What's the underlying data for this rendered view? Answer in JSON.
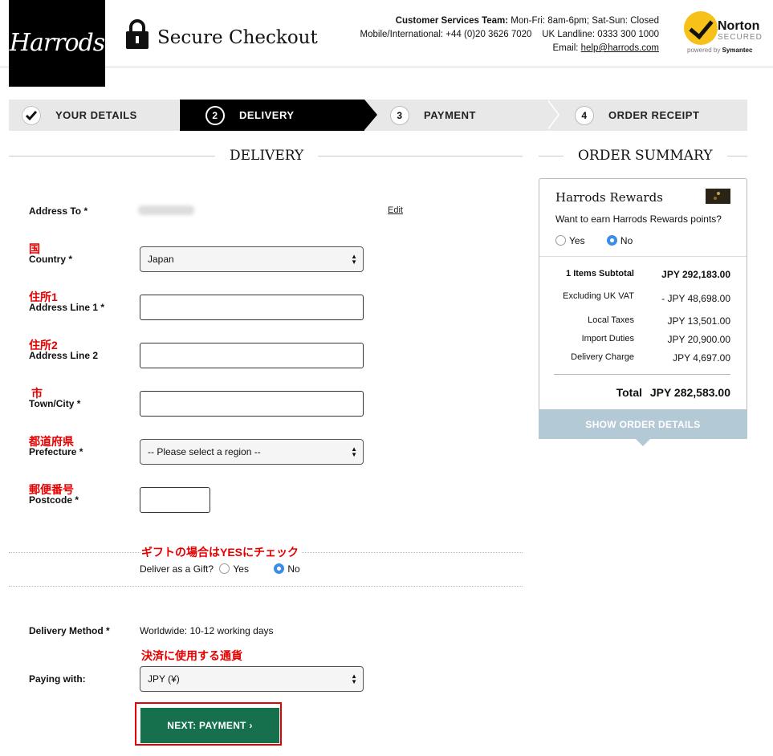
{
  "header": {
    "logo": "Harrods",
    "title": "Secure Checkout",
    "contact": {
      "team_label": "Customer Services Team:",
      "hours": "Mon-Fri: 8am-6pm; Sat-Sun: Closed",
      "mobile": "Mobile/International: +44 (0)20 3626 7020",
      "landline": "UK Landline: 0333 300 1000",
      "email_label": "Email:",
      "email": "help@harrods.com"
    },
    "norton": {
      "name": "Norton",
      "secured": "SECURED",
      "powered": "powered by",
      "brand": "Symantec"
    }
  },
  "steps": [
    {
      "num": "✓",
      "label": "YOUR DETAILS",
      "state": "done"
    },
    {
      "num": "2",
      "label": "DELIVERY",
      "state": "active"
    },
    {
      "num": "3",
      "label": "PAYMENT",
      "state": "todo"
    },
    {
      "num": "4",
      "label": "ORDER RECEIPT",
      "state": "todo"
    }
  ],
  "delivery": {
    "title": "DELIVERY",
    "address_to_label": "Address To *",
    "edit_label": "Edit",
    "country": {
      "jp": "国",
      "label": "Country *",
      "value": "Japan"
    },
    "line1": {
      "jp": "住所1",
      "label": "Address Line 1 *",
      "value": ""
    },
    "line2": {
      "jp": "住所2",
      "label": "Address Line 2",
      "value": ""
    },
    "city": {
      "jp": "市",
      "label": "Town/City *",
      "value": ""
    },
    "prefecture": {
      "jp": "都道府県",
      "label": "Prefecture *",
      "value": "-- Please select a region --"
    },
    "postcode": {
      "jp": "郵便番号",
      "label": "Postcode *",
      "value": ""
    },
    "gift": {
      "note_jp": "ギフトの場合はYESにチェック",
      "question": "Deliver as a Gift?",
      "yes": "Yes",
      "no": "No",
      "selected": "No"
    },
    "method": {
      "label": "Delivery Method *",
      "value": "Worldwide: 10-12 working days"
    },
    "currency": {
      "note_jp": "決済に使用する通貨",
      "label": "Paying with:",
      "value": "JPY (¥)"
    },
    "next_button": "NEXT: PAYMENT ›"
  },
  "summary": {
    "title": "ORDER SUMMARY",
    "rewards_title": "Harrods Rewards",
    "rewards_question": "Want to earn Harrods Rewards points?",
    "yes": "Yes",
    "no": "No",
    "rows": [
      {
        "label": "1 Items Subtotal",
        "value": "JPY 292,183.00"
      },
      {
        "label": "Excluding UK VAT",
        "value": "- JPY 48,698.00"
      },
      {
        "label": "Local Taxes",
        "value": "JPY 13,501.00"
      },
      {
        "label": "Import Duties",
        "value": "JPY 20,900.00"
      },
      {
        "label": "Delivery Charge",
        "value": "JPY 4,697.00"
      }
    ],
    "total_label": "Total",
    "total_value": "JPY 282,583.00",
    "show_details": "SHOW ORDER DETAILS"
  },
  "colors": {
    "accent_green": "#17704d",
    "annotation_red": "#e60000",
    "summary_button": "#b4c9d6",
    "radio_selected": "#3b8de6"
  }
}
